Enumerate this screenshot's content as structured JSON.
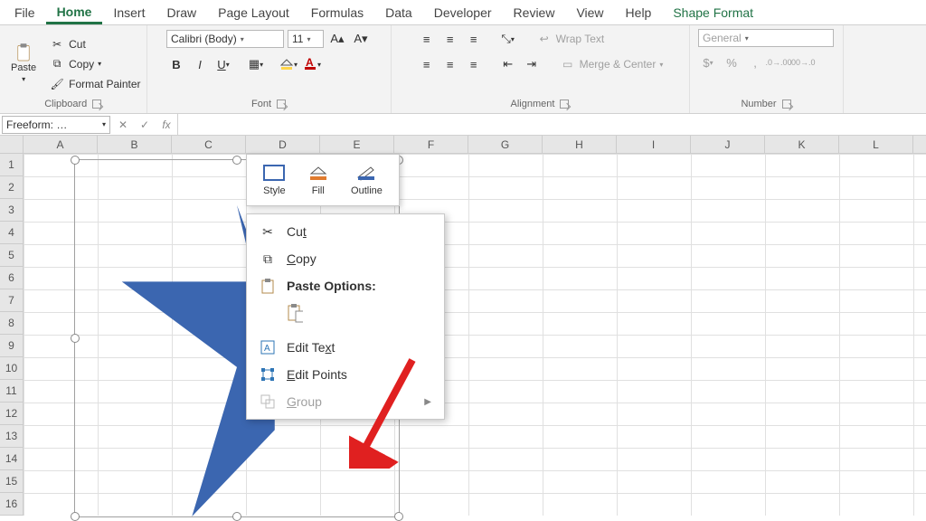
{
  "tabs": {
    "file": "File",
    "home": "Home",
    "insert": "Insert",
    "draw": "Draw",
    "page_layout": "Page Layout",
    "formulas": "Formulas",
    "data": "Data",
    "developer": "Developer",
    "review": "Review",
    "view": "View",
    "help": "Help",
    "shape_format": "Shape Format"
  },
  "ribbon": {
    "clipboard": {
      "paste": "Paste",
      "cut": "Cut",
      "copy": "Copy",
      "format_painter": "Format Painter",
      "label": "Clipboard"
    },
    "font": {
      "name": "Calibri (Body)",
      "size": "11",
      "label": "Font"
    },
    "alignment": {
      "wrap_text": "Wrap Text",
      "merge_center": "Merge & Center",
      "label": "Alignment"
    },
    "number": {
      "format": "General",
      "label": "Number"
    }
  },
  "formula_bar": {
    "name_box": "Freeform: …",
    "fx": "fx"
  },
  "columns": [
    "A",
    "B",
    "C",
    "D",
    "E",
    "F",
    "G",
    "H",
    "I",
    "J",
    "K",
    "L"
  ],
  "rows": [
    "1",
    "2",
    "3",
    "4",
    "5",
    "6",
    "7",
    "8",
    "9",
    "10",
    "11",
    "12",
    "13",
    "14",
    "15",
    "16"
  ],
  "mini_toolbar": {
    "style": "Style",
    "fill": "Fill",
    "outline": "Outline"
  },
  "context_menu": {
    "cut": "Cut",
    "copy": "Copy",
    "paste_options": "Paste Options:",
    "edit_text": "Edit Text",
    "edit_points": "Edit Points",
    "group": "Group"
  },
  "colors": {
    "shape_fill": "#3b66b0",
    "accent": "#217346",
    "fill_swatch": "#e07b2e",
    "outline_swatch": "#3b66b0"
  }
}
